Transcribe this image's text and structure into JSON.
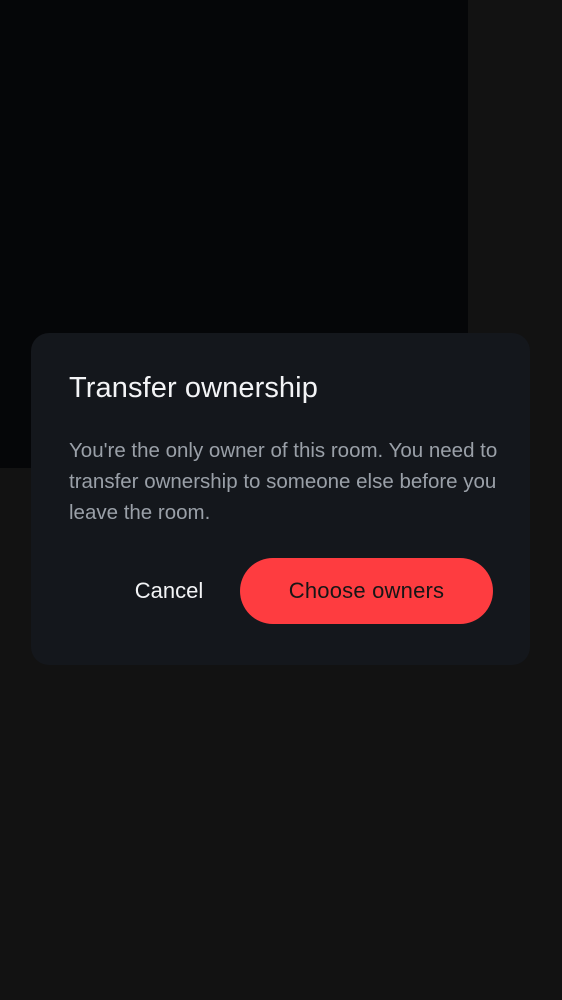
{
  "dialog": {
    "title": "Transfer ownership",
    "body": "You're the only owner of this room. You need to transfer ownership to someone else before you leave the room.",
    "cancel_label": "Cancel",
    "confirm_label": "Choose owners"
  },
  "colors": {
    "background": "#121212",
    "scrim": "#050608",
    "dialog_surface": "#14171c",
    "title_text": "#f3f4f6",
    "body_text": "#9aa0a8",
    "accent": "#fe3c40"
  }
}
